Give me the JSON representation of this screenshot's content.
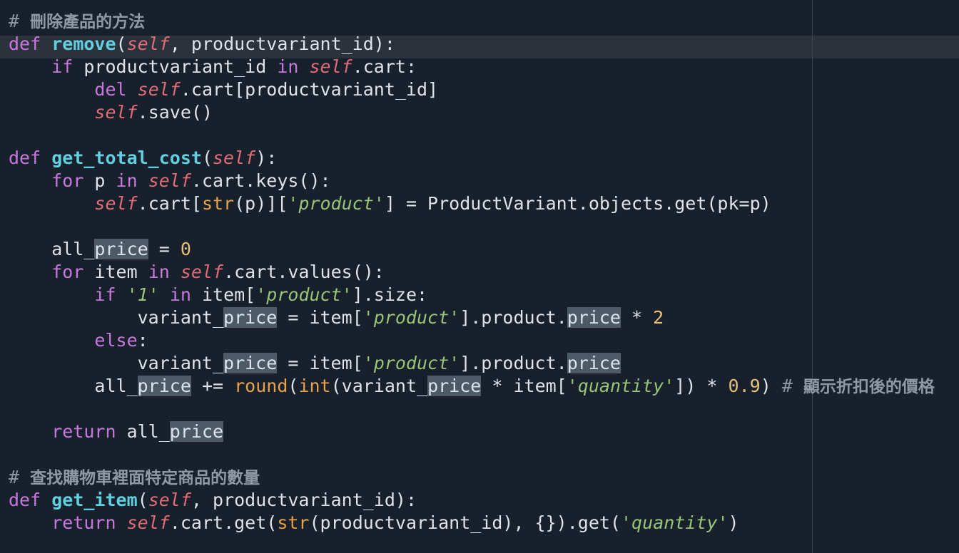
{
  "editor": {
    "language": "python",
    "current_line": 2,
    "colors": {
      "background": "#18202b",
      "current_line": "#2b323c",
      "keyword": "#c678dd",
      "function": "#61cfe0",
      "self": "#e06c75",
      "string": "#98c379",
      "number": "#e5c07b",
      "builtin": "#e5a24b",
      "comment": "#8f99a5",
      "highlight": "#4c5966"
    },
    "highlighted_word": "price",
    "lines": [
      [
        {
          "t": "# ",
          "c": "cmt"
        },
        {
          "t": "刪除產品的方法",
          "c": "cmt cjk"
        }
      ],
      [
        {
          "t": "def",
          "c": "kw"
        },
        {
          "t": " "
        },
        {
          "t": "remove",
          "c": "fn"
        },
        {
          "t": "("
        },
        {
          "t": "self",
          "c": "self"
        },
        {
          "t": ", productvariant_id):"
        }
      ],
      [
        {
          "t": "    "
        },
        {
          "t": "if",
          "c": "kw"
        },
        {
          "t": " productvariant_id "
        },
        {
          "t": "in",
          "c": "kw"
        },
        {
          "t": " "
        },
        {
          "t": "self",
          "c": "self"
        },
        {
          "t": ".cart:"
        }
      ],
      [
        {
          "t": "        "
        },
        {
          "t": "del",
          "c": "kw"
        },
        {
          "t": " "
        },
        {
          "t": "self",
          "c": "self"
        },
        {
          "t": ".cart[productvariant_id]"
        }
      ],
      [
        {
          "t": "        "
        },
        {
          "t": "self",
          "c": "self"
        },
        {
          "t": ".save()"
        }
      ],
      [],
      [
        {
          "t": "def",
          "c": "kw"
        },
        {
          "t": " "
        },
        {
          "t": "get_total_cost",
          "c": "fn"
        },
        {
          "t": "("
        },
        {
          "t": "self",
          "c": "self"
        },
        {
          "t": "):"
        }
      ],
      [
        {
          "t": "    "
        },
        {
          "t": "for",
          "c": "kw"
        },
        {
          "t": " p "
        },
        {
          "t": "in",
          "c": "kw"
        },
        {
          "t": " "
        },
        {
          "t": "self",
          "c": "self"
        },
        {
          "t": ".cart.keys():"
        }
      ],
      [
        {
          "t": "        "
        },
        {
          "t": "self",
          "c": "self"
        },
        {
          "t": ".cart["
        },
        {
          "t": "str",
          "c": "bi"
        },
        {
          "t": "(p)]["
        },
        {
          "t": "'product'",
          "c": "str"
        },
        {
          "t": "] = ProductVariant.objects.get(pk=p)"
        }
      ],
      [],
      [
        {
          "t": "    all_"
        },
        {
          "t": "price",
          "c": "hl"
        },
        {
          "t": " = "
        },
        {
          "t": "0",
          "c": "num"
        }
      ],
      [
        {
          "t": "    "
        },
        {
          "t": "for",
          "c": "kw"
        },
        {
          "t": " item "
        },
        {
          "t": "in",
          "c": "kw"
        },
        {
          "t": " "
        },
        {
          "t": "self",
          "c": "self"
        },
        {
          "t": ".cart.values():"
        }
      ],
      [
        {
          "t": "        "
        },
        {
          "t": "if",
          "c": "kw"
        },
        {
          "t": " "
        },
        {
          "t": "'1'",
          "c": "str"
        },
        {
          "t": " "
        },
        {
          "t": "in",
          "c": "kw"
        },
        {
          "t": " item["
        },
        {
          "t": "'product'",
          "c": "str"
        },
        {
          "t": "].size:"
        }
      ],
      [
        {
          "t": "            variant_"
        },
        {
          "t": "price",
          "c": "hl"
        },
        {
          "t": " = item["
        },
        {
          "t": "'product'",
          "c": "str"
        },
        {
          "t": "].product."
        },
        {
          "t": "price",
          "c": "hl"
        },
        {
          "t": " * "
        },
        {
          "t": "2",
          "c": "num"
        }
      ],
      [
        {
          "t": "        "
        },
        {
          "t": "else",
          "c": "kw"
        },
        {
          "t": ":"
        }
      ],
      [
        {
          "t": "            variant_"
        },
        {
          "t": "price",
          "c": "hl"
        },
        {
          "t": " = item["
        },
        {
          "t": "'product'",
          "c": "str"
        },
        {
          "t": "].product."
        },
        {
          "t": "price",
          "c": "hl"
        }
      ],
      [
        {
          "t": "        all_"
        },
        {
          "t": "price",
          "c": "hl"
        },
        {
          "t": " += "
        },
        {
          "t": "round",
          "c": "bi"
        },
        {
          "t": "("
        },
        {
          "t": "int",
          "c": "bi"
        },
        {
          "t": "(variant_"
        },
        {
          "t": "price",
          "c": "hl"
        },
        {
          "t": " * item["
        },
        {
          "t": "'quantity'",
          "c": "str"
        },
        {
          "t": "]) * "
        },
        {
          "t": "0.9",
          "c": "num"
        },
        {
          "t": ") "
        },
        {
          "t": "# ",
          "c": "cmt"
        },
        {
          "t": "顯示折扣後的價格",
          "c": "cmt cjk"
        }
      ],
      [],
      [
        {
          "t": "    "
        },
        {
          "t": "return",
          "c": "kw"
        },
        {
          "t": " all_"
        },
        {
          "t": "price",
          "c": "hl"
        }
      ],
      [],
      [
        {
          "t": "# ",
          "c": "cmt"
        },
        {
          "t": "查找購物車裡面特定商品的數量",
          "c": "cmt cjk"
        }
      ],
      [
        {
          "t": "def",
          "c": "kw"
        },
        {
          "t": " "
        },
        {
          "t": "get_item",
          "c": "fn"
        },
        {
          "t": "("
        },
        {
          "t": "self",
          "c": "self"
        },
        {
          "t": ", productvariant_id):"
        }
      ],
      [
        {
          "t": "    "
        },
        {
          "t": "return",
          "c": "kw"
        },
        {
          "t": " "
        },
        {
          "t": "self",
          "c": "self"
        },
        {
          "t": ".cart.get("
        },
        {
          "t": "str",
          "c": "bi"
        },
        {
          "t": "(productvariant_id), {}).get("
        },
        {
          "t": "'quantity'",
          "c": "str"
        },
        {
          "t": ")"
        }
      ]
    ]
  }
}
